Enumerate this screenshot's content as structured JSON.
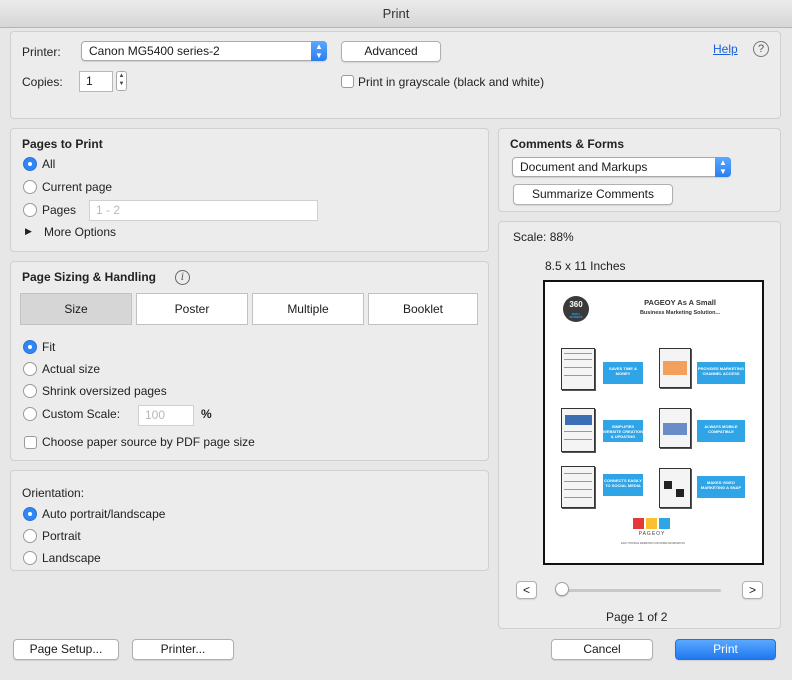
{
  "window": {
    "title": "Print"
  },
  "printer": {
    "label": "Printer:",
    "selected": "Canon MG5400 series-2",
    "advanced_label": "Advanced",
    "help_label": "Help",
    "help_icon_glyph": "?"
  },
  "copies": {
    "label": "Copies:",
    "value": "1",
    "grayscale_label": "Print in grayscale (black and white)"
  },
  "pages_to_print": {
    "heading": "Pages to Print",
    "options": [
      "All",
      "Current page",
      "Pages"
    ],
    "selected": "All",
    "pages_placeholder": "1 - 2",
    "more_options_label": "More Options"
  },
  "page_sizing": {
    "heading": "Page Sizing & Handling",
    "info_glyph": "i",
    "tabs": [
      "Size",
      "Poster",
      "Multiple",
      "Booklet"
    ],
    "active_tab": "Size",
    "options": [
      "Fit",
      "Actual size",
      "Shrink oversized pages",
      "Custom Scale:"
    ],
    "selected": "Fit",
    "custom_scale_value": "100",
    "percent_sign": "%",
    "paper_source_label": "Choose paper source by PDF page size"
  },
  "orientation": {
    "heading": "Orientation:",
    "options": [
      "Auto portrait/landscape",
      "Portrait",
      "Landscape"
    ],
    "selected": "Auto portrait/landscape"
  },
  "comments_forms": {
    "heading": "Comments & Forms",
    "selected": "Document and Markups",
    "summarize_label": "Summarize Comments"
  },
  "preview": {
    "scale_label": "Scale:",
    "scale_value": "88%",
    "page_size": "8.5 x 11 Inches",
    "prev_glyph": "<",
    "next_glyph": ">",
    "page_indicator": "Page 1 of 2",
    "slider_position": 0,
    "doc": {
      "badge": "360",
      "badge_sub": "SMALL BUSINESS",
      "title_line1": "PAGEOY As A Small",
      "title_line2": "Business Marketing Solution...",
      "boxes": [
        "SAVES TIME & MONEY",
        "PROVIDES MARKETING CHANNEL ACCESS",
        "SIMPLIFIES WEBSITE CREATION & UPDATING",
        "ALWAYS MOBILE COMPATIBLE",
        "CONNECTS EASILY TO SOCIAL MEDIA",
        "MAKES VIDEO MARKETING A SNAP"
      ],
      "brand": "PAGEOY",
      "footer": "EASY PROFILE WEBSITES FOR MORE INFORMATION"
    }
  },
  "footer": {
    "page_setup_label": "Page Setup...",
    "printer_label": "Printer...",
    "cancel_label": "Cancel",
    "print_label": "Print"
  },
  "colors": {
    "accent": "#2f86f5",
    "flow_box": "#2fa4e7"
  }
}
